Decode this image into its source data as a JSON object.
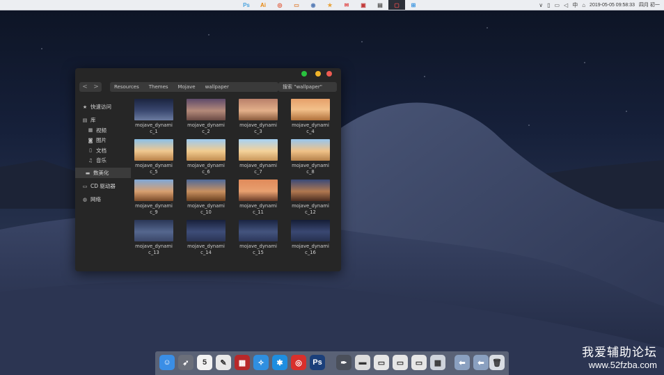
{
  "menubar": {
    "apps": [
      {
        "label": "Ps",
        "color": "#4aa3df"
      },
      {
        "label": "Ai",
        "color": "#e8870e"
      },
      {
        "label": "◎",
        "color": "#e05a3a"
      },
      {
        "label": "▭",
        "color": "#e0823a"
      },
      {
        "label": "◉",
        "color": "#5a7fb8"
      },
      {
        "label": "★",
        "color": "#e8a23a"
      },
      {
        "label": "✉",
        "color": "#e04a4a"
      },
      {
        "label": "▣",
        "color": "#c23a3a"
      },
      {
        "label": "▤",
        "color": "#555555"
      },
      {
        "label": "▢",
        "color": "#e04a4a"
      },
      {
        "label": "⊞",
        "color": "#2f8fe0"
      }
    ],
    "status": {
      "chevron": "∨",
      "input_method": "中",
      "datetime": "2019-05-05  09:58:33",
      "weekday": "四月 初一"
    }
  },
  "finder": {
    "nav_back": "<",
    "nav_forward": ">",
    "breadcrumbs": [
      "Resources",
      "Themes",
      "Mojave",
      "wallpaper"
    ],
    "search_placeholder": "搜索 \"wallpaper\"",
    "sidebar": {
      "quick_access": "快速访问",
      "library": "库",
      "video": "视频",
      "pictures": "图片",
      "documents": "文档",
      "music": "音乐",
      "digitalize": "数美化",
      "cd_drive": "CD 驱动器",
      "network": "网络"
    },
    "files": [
      {
        "line1": "mojave_dynami",
        "line2": "c_1"
      },
      {
        "line1": "mojave_dynami",
        "line2": "c_2"
      },
      {
        "line1": "mojave_dynami",
        "line2": "c_3"
      },
      {
        "line1": "mojave_dynami",
        "line2": "c_4"
      },
      {
        "line1": "mojave_dynami",
        "line2": "c_5"
      },
      {
        "line1": "mojave_dynami",
        "line2": "c_6"
      },
      {
        "line1": "mojave_dynami",
        "line2": "c_7"
      },
      {
        "line1": "mojave_dynami",
        "line2": "c_8"
      },
      {
        "line1": "mojave_dynami",
        "line2": "c_9"
      },
      {
        "line1": "mojave_dynami",
        "line2": "c_10"
      },
      {
        "line1": "mojave_dynami",
        "line2": "c_11"
      },
      {
        "line1": "mojave_dynami",
        "line2": "c_12"
      },
      {
        "line1": "mojave_dynami",
        "line2": "c_13"
      },
      {
        "line1": "mojave_dynami",
        "line2": "c_14"
      },
      {
        "line1": "mojave_dynami",
        "line2": "c_15"
      },
      {
        "line1": "mojave_dynami",
        "line2": "c_16"
      }
    ]
  },
  "dock": {
    "items": [
      {
        "name": "finder-icon",
        "glyph": "☺",
        "color": "#3a8ee6"
      },
      {
        "name": "launchpad-icon",
        "glyph": "➶",
        "color": "#6b6f7a"
      },
      {
        "name": "calendar-icon",
        "glyph": "5",
        "color": "#f2f2f2"
      },
      {
        "name": "notes-icon",
        "glyph": "✎",
        "color": "#e8e8e8"
      },
      {
        "name": "photo-booth-icon",
        "glyph": "▦",
        "color": "#b8282a"
      },
      {
        "name": "safari-icon",
        "glyph": "✧",
        "color": "#2f8fe0"
      },
      {
        "name": "app-store-icon",
        "glyph": "✱",
        "color": "#1e8ee0"
      },
      {
        "name": "netease-music-icon",
        "glyph": "◎",
        "color": "#d8302c"
      },
      {
        "name": "photoshop-icon",
        "glyph": "Ps",
        "color": "#1b3f7a"
      },
      {
        "name": "pen-tool-icon",
        "glyph": "✒",
        "color": "#4a4f5a"
      },
      {
        "name": "window-thumb-1-icon",
        "glyph": "▬",
        "color": "#dcdcdc"
      },
      {
        "name": "window-thumb-2-icon",
        "glyph": "▭",
        "color": "#e6e6e6"
      },
      {
        "name": "window-thumb-3-icon",
        "glyph": "▭",
        "color": "#e6e6e6"
      },
      {
        "name": "window-thumb-4-icon",
        "glyph": "▭",
        "color": "#e6e6e6"
      },
      {
        "name": "grid-view-icon",
        "glyph": "▦",
        "color": "#cfd4dc"
      },
      {
        "name": "arrow-left-icon",
        "glyph": "⬅",
        "color": "#8aa0c0"
      },
      {
        "name": "arrow-left-2-icon",
        "glyph": "⬅",
        "color": "#8aa0c0"
      },
      {
        "name": "trash-icon",
        "glyph": "🗑",
        "color": "#d9dde3"
      }
    ]
  },
  "watermark": {
    "line1": "我爱辅助论坛",
    "line2": "www.52fzba.com"
  }
}
